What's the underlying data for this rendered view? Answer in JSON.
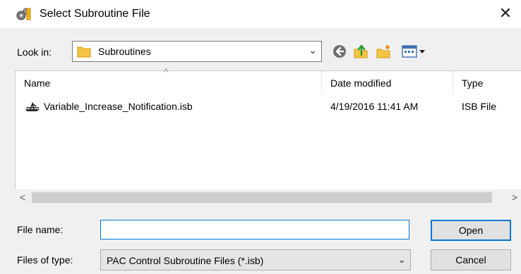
{
  "window": {
    "title": "Select Subroutine File",
    "close_glyph": "✕"
  },
  "look_in": {
    "label": "Look in:",
    "value": "Subroutines",
    "icon": "folder-icon"
  },
  "toolbar": {
    "icons": [
      "back-icon",
      "up-folder-icon",
      "new-folder-icon",
      "views-menu-icon"
    ]
  },
  "file_list": {
    "columns": [
      "Name",
      "Date modified",
      "Type"
    ],
    "sort_caret": "^",
    "rows": [
      {
        "name": "Variable_Increase_Notification.isb",
        "date_modified": "4/19/2016 11:41 AM",
        "type": "ISB File",
        "icon": "subroutine-file-icon"
      }
    ]
  },
  "scrollbar": {
    "left_arrow": "<",
    "right_arrow": ">"
  },
  "file_name": {
    "label": "File name:",
    "value": ""
  },
  "files_of_type": {
    "label": "Files of type:",
    "value": "PAC Control Subroutine Files (*.isb)"
  },
  "buttons": {
    "open": "Open",
    "cancel": "Cancel"
  },
  "colors": {
    "accent": "#0078d7",
    "folder": "#f5c342"
  }
}
